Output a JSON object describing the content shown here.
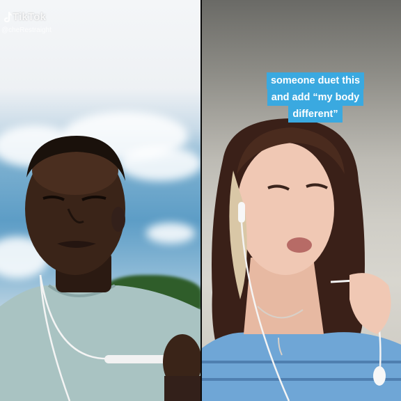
{
  "watermark": {
    "brand": "TikTok",
    "username": "@cheRestraight",
    "icon": "tiktok-note-icon"
  },
  "caption": {
    "lines": [
      "someone duet this",
      "and add “my body",
      "different”"
    ],
    "bg_color": "#3aa9e0",
    "text_color": "#ffffff"
  }
}
